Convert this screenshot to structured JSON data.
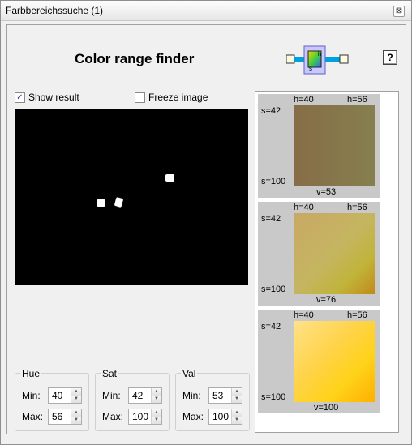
{
  "window": {
    "title": "Farbbereichssuche (1)",
    "close_symbol": "⊠"
  },
  "header": {
    "title": "Color range finder",
    "help_label": "?"
  },
  "options": {
    "show_result": {
      "label": "Show result",
      "checked": true
    },
    "freeze_image": {
      "label": "Freeze image",
      "checked": false
    }
  },
  "groups": {
    "hue": {
      "title": "Hue",
      "min_label": "Min:",
      "min": "40",
      "max_label": "Max:",
      "max": "56"
    },
    "sat": {
      "title": "Sat",
      "min_label": "Min:",
      "min": "42",
      "max_label": "Max:",
      "max": "100"
    },
    "val": {
      "title": "Val",
      "min_label": "Min:",
      "min": "53",
      "max_label": "Max:",
      "max": "100"
    }
  },
  "cards": [
    {
      "h_min": "h=40",
      "h_max": "h=56",
      "s_min": "s=42",
      "s_max": "s=100",
      "v": "v=53"
    },
    {
      "h_min": "h=40",
      "h_max": "h=56",
      "s_min": "s=42",
      "s_max": "s=100",
      "v": "v=76"
    },
    {
      "h_min": "h=40",
      "h_max": "h=56",
      "s_min": "s=42",
      "s_max": "s=100",
      "v": "v=100"
    }
  ],
  "colors": {
    "accent": "#00a0e0",
    "preview_bg": "#000000"
  }
}
